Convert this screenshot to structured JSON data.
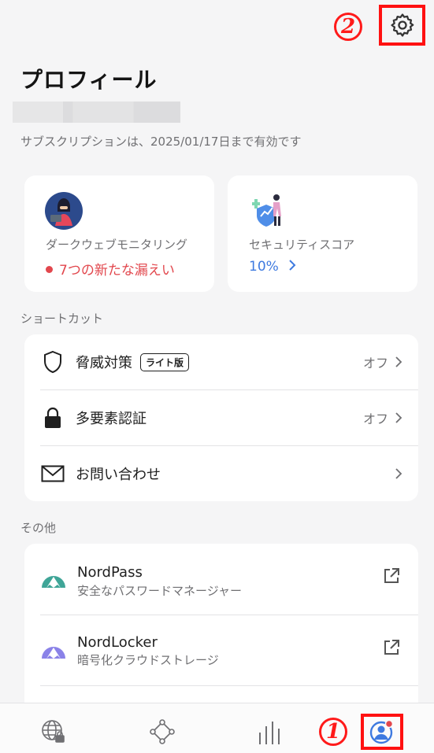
{
  "header": {
    "title": "プロフィール",
    "subscription": "サブスクリプションは、2025/01/17日まで有効です",
    "annotation_settings": "2",
    "annotation_profile": "1"
  },
  "cards": {
    "dark_web": {
      "label": "ダークウェブモニタリング",
      "status": "7つの新たな漏えい"
    },
    "security_score": {
      "label": "セキュリティスコア",
      "status": "10%"
    }
  },
  "shortcuts": {
    "section_label": "ショートカット",
    "items": [
      {
        "label": "脅威対策",
        "badge": "ライト版",
        "value": "オフ"
      },
      {
        "label": "多要素認証",
        "value": "オフ"
      },
      {
        "label": "お問い合わせ"
      }
    ]
  },
  "other": {
    "section_label": "その他",
    "apps": [
      {
        "name": "NordPass",
        "description": "安全なパスワードマネージャー",
        "color": "#3fa597"
      },
      {
        "name": "NordLocker",
        "description": "暗号化クラウドストレージ",
        "color": "#8a82e8"
      }
    ]
  },
  "colors": {
    "accent_blue": "#3e7ae0",
    "alert_red": "#e2474d",
    "highlight": "#ff1111"
  }
}
